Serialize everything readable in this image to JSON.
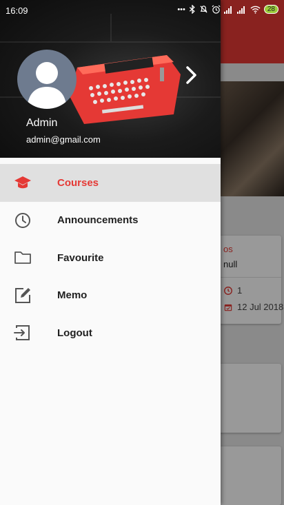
{
  "status_bar": {
    "time": "16:09",
    "icons": [
      "dots-icon",
      "bluetooth-icon",
      "mute-icon",
      "alarm-icon",
      "signal-icon",
      "signal-hd-icon",
      "wifi-icon"
    ],
    "battery": "28"
  },
  "drawer": {
    "header": {
      "user_name": "Admin",
      "user_email": "admin@gmail.com"
    },
    "menu_items": [
      {
        "label": "Courses",
        "icon": "graduation-cap-icon",
        "active": true
      },
      {
        "label": "Announcements",
        "icon": "clock-icon",
        "active": false
      },
      {
        "label": "Favourite",
        "icon": "folder-icon",
        "active": false
      },
      {
        "label": "Memo",
        "icon": "edit-icon",
        "active": false
      },
      {
        "label": "Logout",
        "icon": "logout-icon",
        "active": false
      }
    ]
  },
  "background": {
    "card": {
      "title_fragment": "os",
      "subtitle": "null",
      "count": "1",
      "date": "12 Jul 2018"
    }
  },
  "colors": {
    "accent": "#e53935",
    "active_background": "#e0e0e0",
    "drawer_background": "#fafafa"
  }
}
